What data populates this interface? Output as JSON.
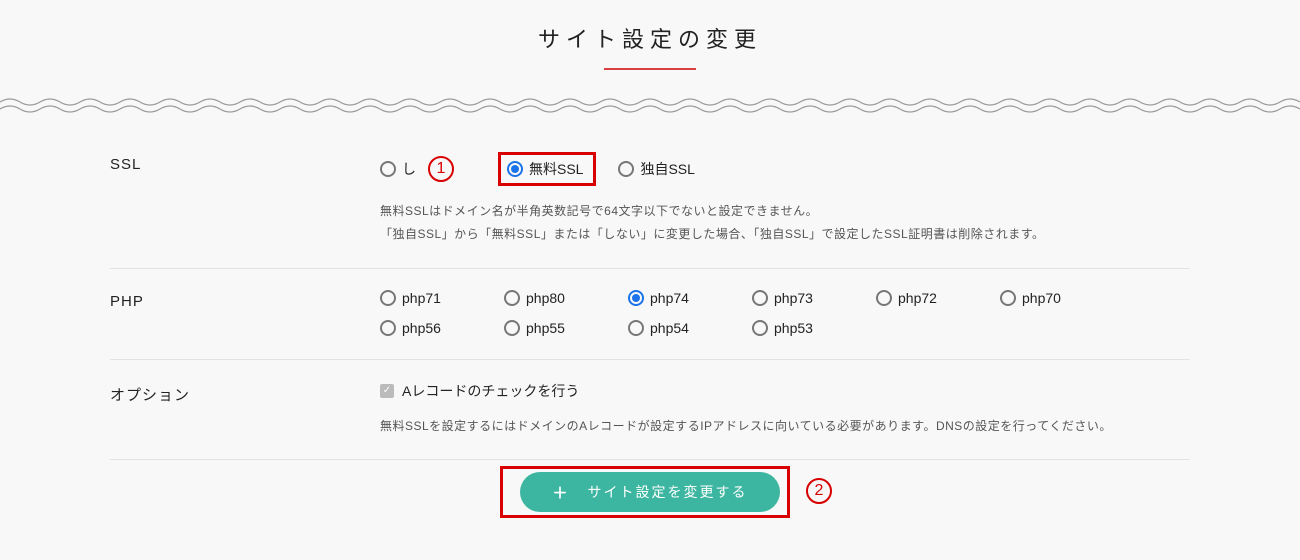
{
  "title": "サイト設定の変更",
  "ssl": {
    "label": "SSL",
    "options": [
      "しない",
      "無料SSL",
      "独自SSL"
    ],
    "opt0_visible": "し",
    "selected": 1,
    "note1": "無料SSLはドメイン名が半角英数記号で64文字以下でないと設定できません。",
    "note2": "「独自SSL」から「無料SSL」または「しない」に変更した場合、「独自SSL」で設定したSSL証明書は削除されます。"
  },
  "php": {
    "label": "PHP",
    "options": [
      "php71",
      "php80",
      "php74",
      "php73",
      "php72",
      "php70",
      "php56",
      "php55",
      "php54",
      "php53"
    ],
    "selected": 2
  },
  "option": {
    "label": "オプション",
    "checkbox_label": "Aレコードのチェックを行う",
    "checked": true,
    "note": "無料SSLを設定するにはドメインのAレコードが設定するIPアドレスに向いている必要があります。DNSの設定を行ってください。"
  },
  "submit_label": "サイト設定を変更する",
  "callouts": {
    "one": "1",
    "two": "2"
  }
}
